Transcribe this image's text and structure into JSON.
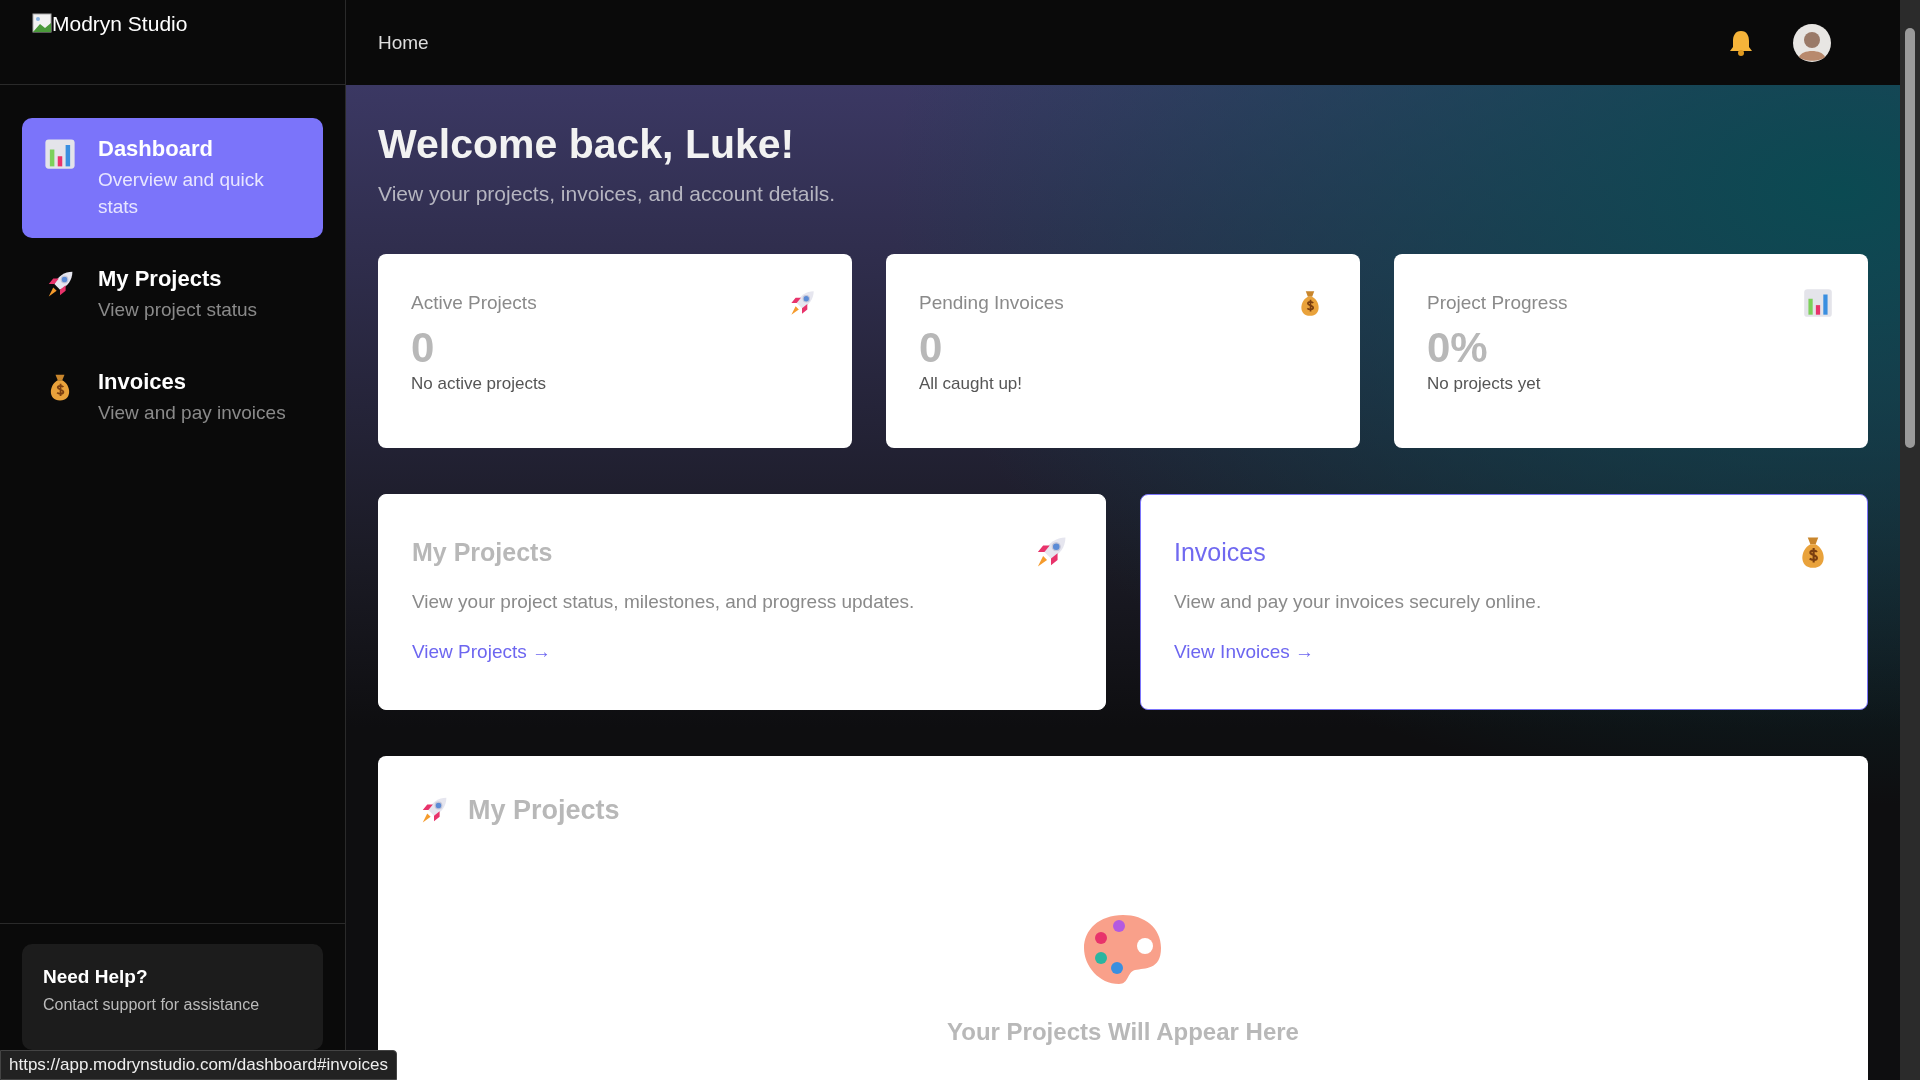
{
  "brand": {
    "name": "Modryn Studio"
  },
  "topbar": {
    "breadcrumb": "Home"
  },
  "sidebar": {
    "items": [
      {
        "title": "Dashboard",
        "subtitle": "Overview and quick stats",
        "selected": true
      },
      {
        "title": "My Projects",
        "subtitle": "View project status",
        "selected": false
      },
      {
        "title": "Invoices",
        "subtitle": "View and pay invoices",
        "selected": false
      }
    ],
    "help": {
      "title": "Need Help?",
      "text": "Contact support for assistance"
    }
  },
  "hero": {
    "title": "Welcome back, Luke!",
    "subtitle": "View your projects, invoices, and account details."
  },
  "stats": [
    {
      "label": "Active Projects",
      "value": "0",
      "note": "No active projects"
    },
    {
      "label": "Pending Invoices",
      "value": "0",
      "note": "All caught up!"
    },
    {
      "label": "Project Progress",
      "value": "0%",
      "note": "No projects yet"
    }
  ],
  "quick_links": [
    {
      "title": "My Projects",
      "text": "View your project status, milestones, and progress updates.",
      "link": "View Projects →",
      "selected": false
    },
    {
      "title": "Invoices",
      "text": "View and pay your invoices securely online.",
      "link": "View Invoices →",
      "selected": true
    }
  ],
  "projects_panel": {
    "title": "My Projects",
    "empty_title": "Your Projects Will Appear Here"
  },
  "status_url": "https://app.modrynstudio.com/dashboard#invoices"
}
